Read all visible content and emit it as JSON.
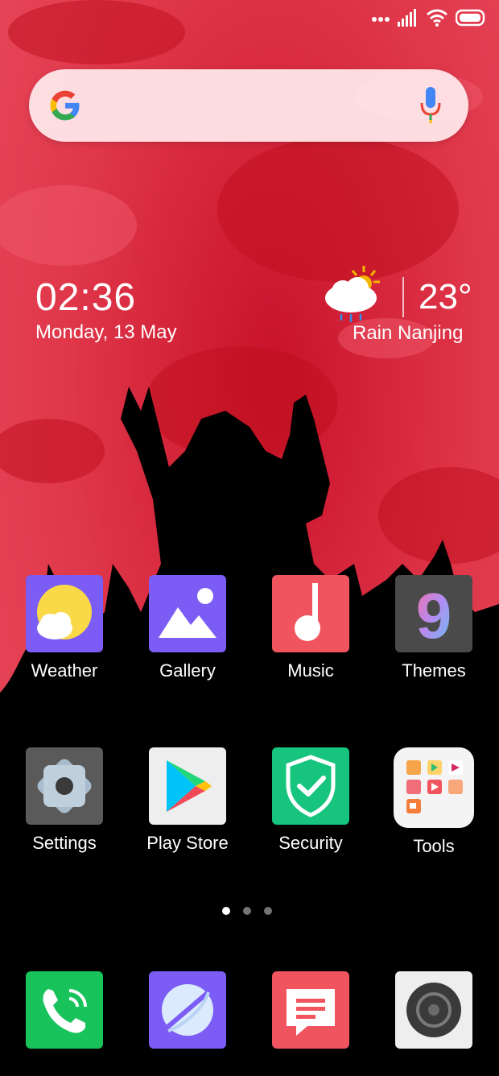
{
  "status_bar": {
    "icons": [
      "more-dots-icon",
      "signal-icon",
      "wifi-icon",
      "battery-icon"
    ]
  },
  "search": {
    "placeholder": "",
    "icons": [
      "google-icon",
      "mic-icon"
    ]
  },
  "clock": {
    "time": "02:36",
    "date": "Monday, 13 May"
  },
  "weather": {
    "temperature": "23°",
    "location": "Rain Nanjing",
    "icon": "rain-cloud-sun-icon"
  },
  "apps": [
    {
      "label": "Weather",
      "icon": "weather-icon"
    },
    {
      "label": "Gallery",
      "icon": "gallery-icon"
    },
    {
      "label": "Music",
      "icon": "music-icon"
    },
    {
      "label": "Themes",
      "icon": "themes-icon"
    },
    {
      "label": "Settings",
      "icon": "settings-icon"
    },
    {
      "label": "Play Store",
      "icon": "play-store-icon"
    },
    {
      "label": "Security",
      "icon": "security-icon"
    },
    {
      "label": "Tools",
      "icon": "tools-folder-icon"
    }
  ],
  "pager": {
    "pages": 3,
    "current": 1
  },
  "dock": [
    {
      "icon": "phone-icon"
    },
    {
      "icon": "browser-icon"
    },
    {
      "icon": "messages-icon"
    },
    {
      "icon": "camera-icon"
    }
  ],
  "colors": {
    "wallpaper_red": "#e23a4c",
    "wallpaper_dark": "#b01225"
  }
}
